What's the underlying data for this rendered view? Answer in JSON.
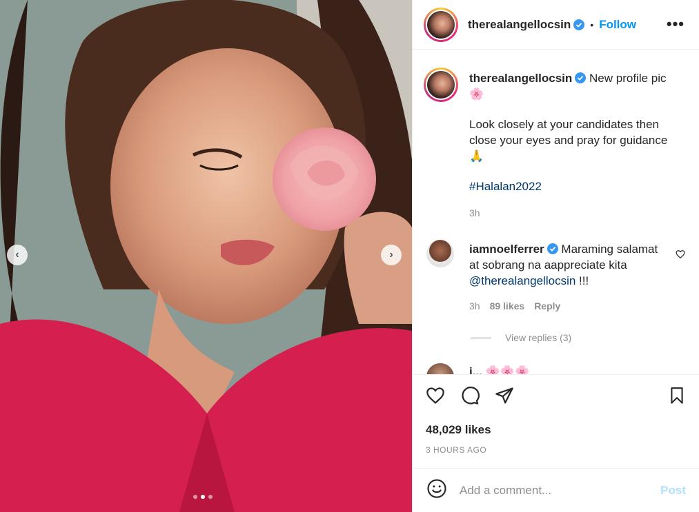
{
  "post": {
    "author": "therealangellocsin",
    "header_separator": "•",
    "follow_label": "Follow",
    "more_label": "•••",
    "carousel": {
      "current_index": 2,
      "total": 3
    },
    "prev_label": "‹",
    "next_label": "›"
  },
  "caption": {
    "author": "therealangellocsin",
    "line1": "New profile pic",
    "line1_emoji": "🌸",
    "line2": "Look closely at your candidates then close your eyes and pray for guidance",
    "line2_emoji": "🙏",
    "hashtag": "#Halalan2022",
    "time": "3h"
  },
  "comment": {
    "author": "iamnoelferrer",
    "text_before": "Maraming salamat at sobrang na aappreciate kita",
    "mention": "@therealangellocsin",
    "text_after": "!!!",
    "time": "3h",
    "likes": "89 likes",
    "reply_label": "Reply",
    "view_replies": "View replies (3)"
  },
  "partial_comment": {
    "author": "i...",
    "emoji": "🌸🌸🌸"
  },
  "actions": {
    "likes": "48,029 likes",
    "posted_time": "3 HOURS AGO"
  },
  "comment_box": {
    "placeholder": "Add a comment...",
    "post_label": "Post"
  },
  "colors": {
    "accent": "#0095f6",
    "hashtag": "#00376b",
    "muted": "#8e8e8e",
    "post_disabled": "#b2dffc"
  }
}
